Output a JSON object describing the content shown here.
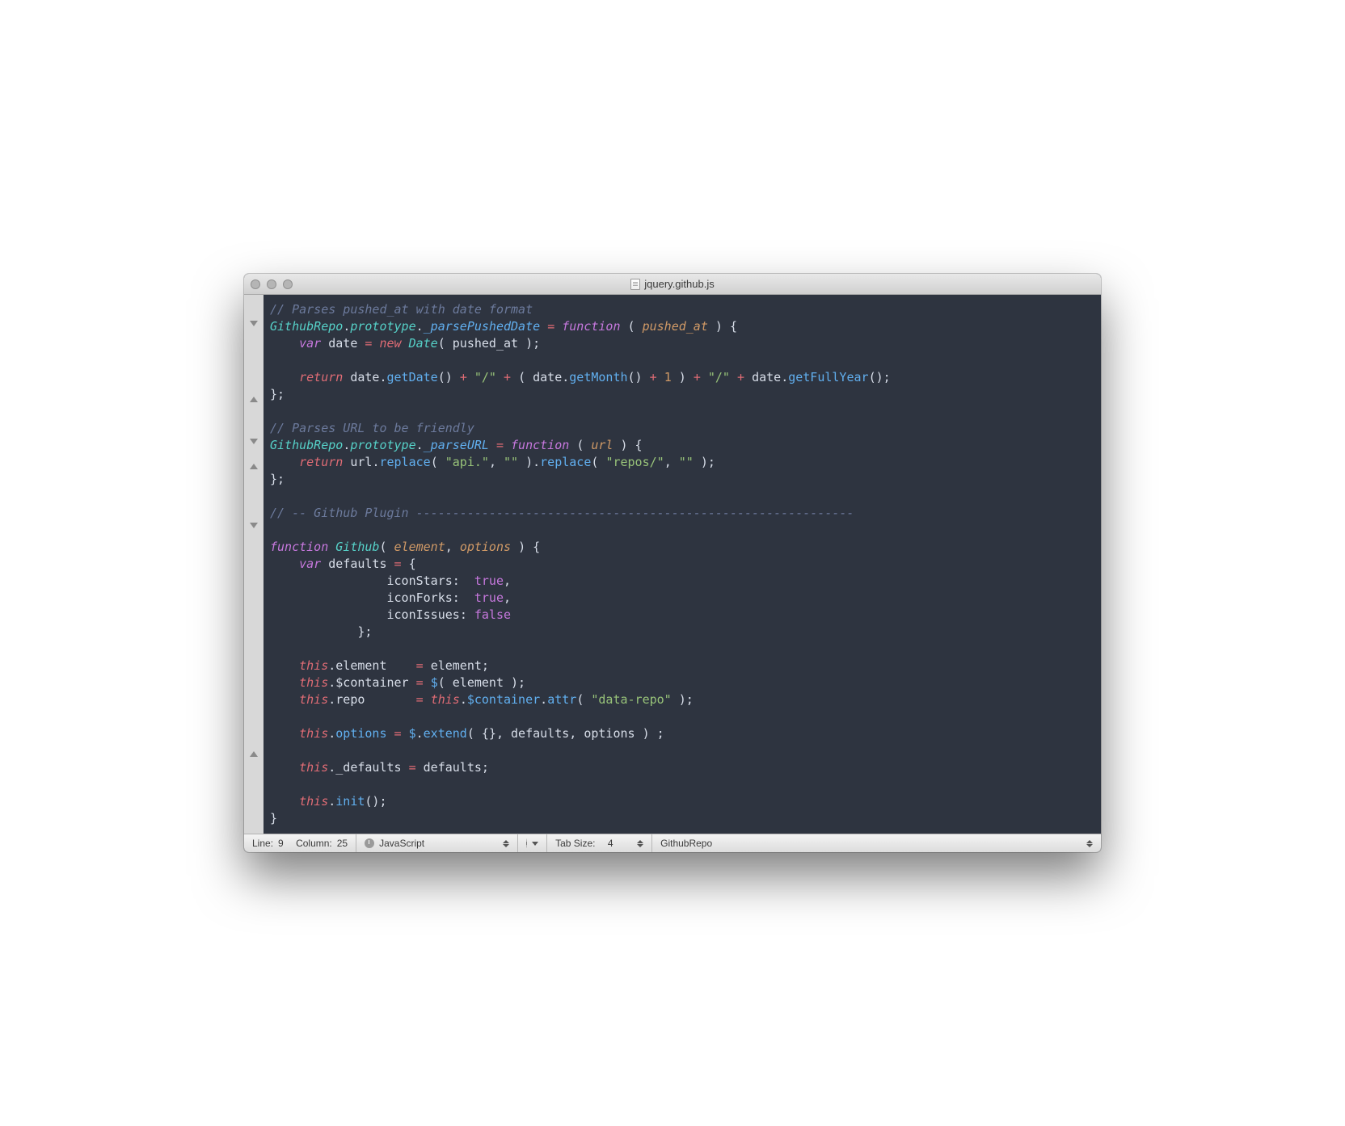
{
  "window": {
    "title": "jquery.github.js"
  },
  "code": {
    "c1": "// Parses pushed_at with date format",
    "l2": {
      "cls": "GithubRepo",
      "proto": "prototype",
      "meth": "_parsePushedDate",
      "fn": "function",
      "p": "pushed_at"
    },
    "l3": {
      "kw": "var",
      "name": "date",
      "nw": "new",
      "type": "Date",
      "arg": "pushed_at"
    },
    "l4": {
      "ret": "return",
      "d1": "date",
      "m1": "getDate",
      "s1": "\"/\"",
      "d2": "date",
      "m2": "getMonth",
      "one": "1",
      "s2": "\"/\"",
      "d3": "date",
      "m3": "getFullYear"
    },
    "c2": "// Parses URL to be friendly",
    "l6": {
      "cls": "GithubRepo",
      "proto": "prototype",
      "meth": "_parseURL",
      "fn": "function",
      "p": "url"
    },
    "l7": {
      "ret": "return",
      "v": "url",
      "r1": "replace",
      "s1": "\"api.\"",
      "s2": "\"\"",
      "r2": "replace",
      "s3": "\"repos/\"",
      "s4": "\"\""
    },
    "c3": "// -- Github Plugin ------------------------------------------------------------",
    "l9": {
      "fn": "function",
      "name": "Github",
      "p1": "element",
      "p2": "options"
    },
    "l10": {
      "kw": "var",
      "name": "defaults"
    },
    "l11": {
      "k": "iconStars",
      "v": "true"
    },
    "l12": {
      "k": "iconForks",
      "v": "true"
    },
    "l13": {
      "k": "iconIssues",
      "v": "false"
    },
    "l14": {
      "t": "this",
      "p": "element",
      "v": "element"
    },
    "l15": {
      "t": "this",
      "p": "$container",
      "d": "$",
      "a": "element"
    },
    "l16": {
      "t": "this",
      "p": "repo",
      "t2": "this",
      "p2": "$container",
      "m": "attr",
      "s": "\"data-repo\""
    },
    "l17": {
      "t": "this",
      "p": "options",
      "d": "$",
      "m": "extend",
      "a1": "defaults",
      "a2": "options"
    },
    "l18": {
      "t": "this",
      "p": "_defaults",
      "v": "defaults"
    },
    "l19": {
      "t": "this",
      "m": "init"
    }
  },
  "status": {
    "line_label": "Line:",
    "line": "9",
    "col_label": "Column:",
    "col": "25",
    "lang": "JavaScript",
    "tab_label": "Tab Size:",
    "tab": "4",
    "symbol": "GithubRepo"
  }
}
